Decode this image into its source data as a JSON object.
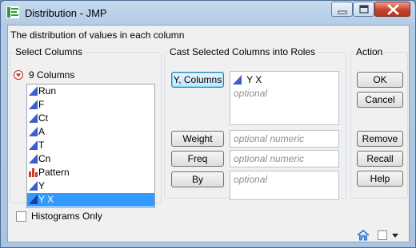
{
  "window": {
    "title": "Distribution - JMP"
  },
  "description": "The distribution of values in each column",
  "select_columns": {
    "legend": "Select Columns",
    "count_label": "9 Columns",
    "columns": [
      {
        "name": "Run",
        "icon": "continuous-icon"
      },
      {
        "name": "F",
        "icon": "continuous-icon"
      },
      {
        "name": "Ct",
        "icon": "continuous-icon"
      },
      {
        "name": "A",
        "icon": "continuous-icon"
      },
      {
        "name": "T",
        "icon": "continuous-icon"
      },
      {
        "name": "Cn",
        "icon": "continuous-icon"
      },
      {
        "name": "Pattern",
        "icon": "nominal-icon"
      },
      {
        "name": "Y",
        "icon": "continuous-icon"
      },
      {
        "name": "Y X",
        "icon": "continuous-icon"
      }
    ],
    "selected": "Y X"
  },
  "cast_roles": {
    "legend": "Cast Selected Columns into Roles",
    "y_columns": {
      "label": "Y, Columns",
      "entries": [
        "Y X"
      ],
      "placeholder": "optional"
    },
    "weight": {
      "label": "Weight",
      "placeholder": "optional numeric"
    },
    "freq": {
      "label": "Freq",
      "placeholder": "optional numeric"
    },
    "by": {
      "label": "By",
      "placeholder": "optional"
    }
  },
  "action": {
    "legend": "Action",
    "ok": "OK",
    "cancel": "Cancel",
    "remove": "Remove",
    "recall": "Recall",
    "help": "Help"
  },
  "options": {
    "histograms_only": {
      "label": "Histograms Only",
      "checked": false
    }
  },
  "colors": {
    "continuous_icon": "#3a5fcd",
    "nominal_icon": "#d43a1f",
    "selection": "#3399ff",
    "title_bar": "#b9d1ea"
  }
}
